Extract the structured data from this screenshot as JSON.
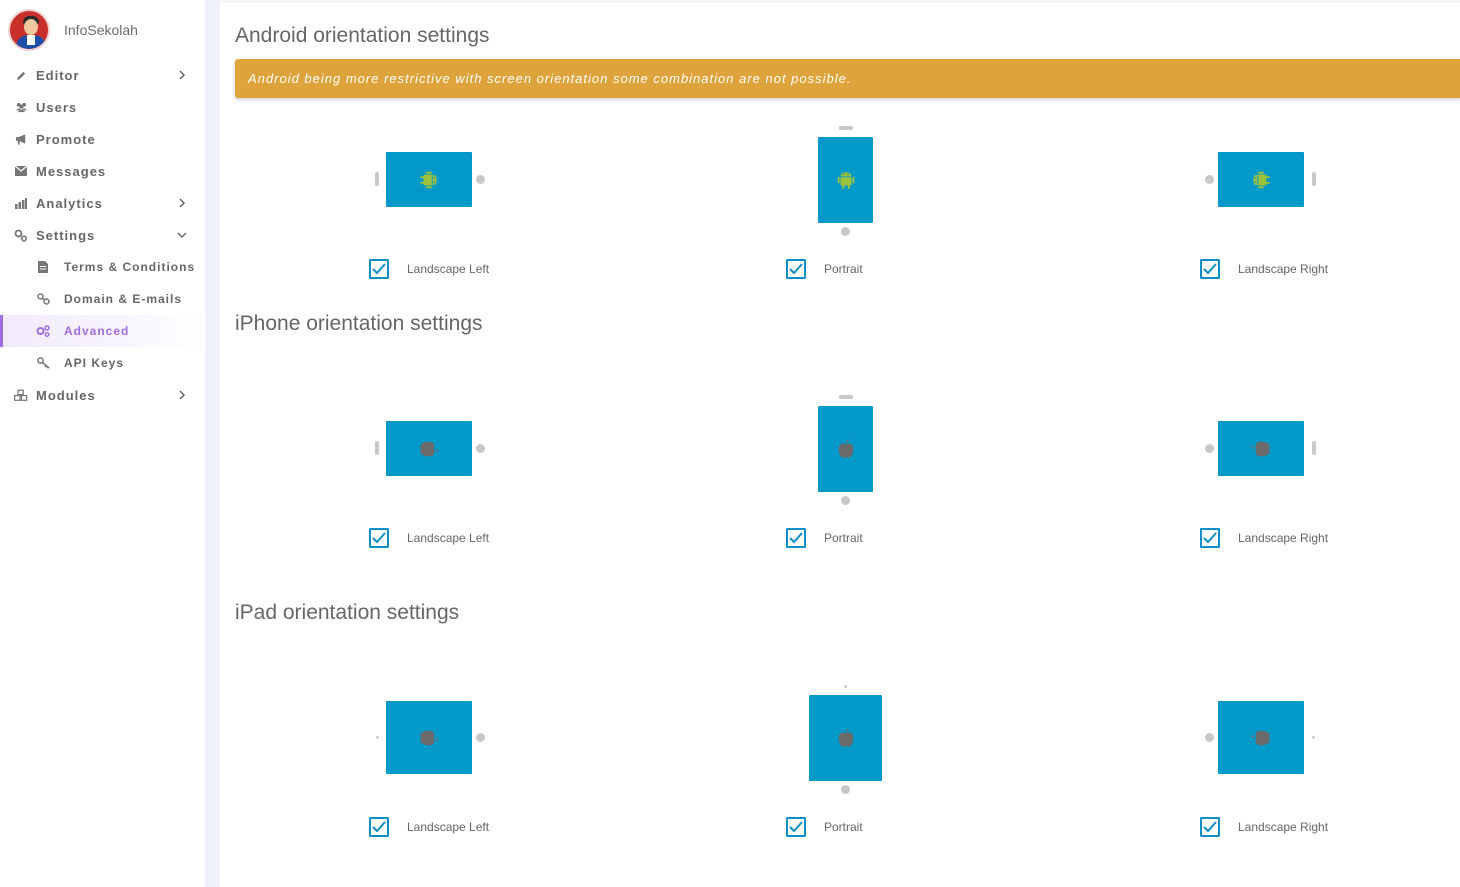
{
  "brand": {
    "name": "InfoSekolah"
  },
  "sidebar": {
    "items": [
      {
        "label": "Editor",
        "icon": "pencil-icon",
        "has_chevron": true
      },
      {
        "label": "Users",
        "icon": "users-icon"
      },
      {
        "label": "Promote",
        "icon": "bullhorn-icon"
      },
      {
        "label": "Messages",
        "icon": "envelope-icon"
      },
      {
        "label": "Analytics",
        "icon": "bar-chart-icon",
        "has_chevron": true
      },
      {
        "label": "Settings",
        "icon": "gears-icon",
        "expanded": true
      },
      {
        "label": "Terms & Conditions",
        "icon": "file-icon",
        "sub": true
      },
      {
        "label": "Domain & E-mails",
        "icon": "link-icon",
        "sub": true
      },
      {
        "label": "Advanced",
        "icon": "cogs-icon",
        "sub": true,
        "active": true
      },
      {
        "label": "API Keys",
        "icon": "key-icon",
        "sub": true
      },
      {
        "label": "Modules",
        "icon": "cubes-icon",
        "has_chevron": true
      }
    ]
  },
  "colors": {
    "accent": "#a06ce0",
    "warning": "#dea33a",
    "device": "#0399c9",
    "checkbox": "#0f8ec8",
    "android_green": "#9cc23c",
    "apple_gray": "#6b6b6b"
  },
  "sections": {
    "android": {
      "title": "Android orientation settings",
      "warning": "Android being more restrictive with screen orientation some combination are not possible.",
      "options": {
        "left": "Landscape Left",
        "portrait": "Portrait",
        "right": "Landscape Right"
      },
      "checked": [
        true,
        true,
        true
      ]
    },
    "iphone": {
      "title": "iPhone orientation settings",
      "options": {
        "left": "Landscape Left",
        "portrait": "Portrait",
        "right": "Landscape Right"
      },
      "checked": [
        true,
        true,
        true
      ]
    },
    "ipad": {
      "title": "iPad orientation settings",
      "options": {
        "left": "Landscape Left",
        "portrait": "Portrait",
        "right": "Landscape Right"
      },
      "checked": [
        true,
        true,
        true
      ]
    }
  }
}
